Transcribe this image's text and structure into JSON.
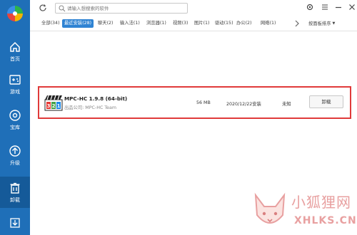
{
  "sidebar": {
    "logo_icon": "colorful-pinwheel-logo",
    "items": [
      {
        "label": "首页",
        "icon": "home-icon",
        "active": false
      },
      {
        "label": "游戏",
        "icon": "gamepad-icon",
        "active": false
      },
      {
        "label": "宝库",
        "icon": "disc-icon",
        "active": false
      },
      {
        "label": "升级",
        "icon": "upgrade-icon",
        "active": false
      },
      {
        "label": "卸载",
        "icon": "trash-icon",
        "active": true
      }
    ],
    "bottom_icon": "download-icon"
  },
  "titlebar": {
    "search_placeholder": "请输入想搜索的软件",
    "icons": [
      "refresh-icon",
      "settings-icon",
      "menu-icon",
      "minimize-icon",
      "close-icon"
    ]
  },
  "tabs": [
    {
      "label": "全部(34)",
      "active": false
    },
    {
      "label": "最近安装(28)",
      "active": true
    },
    {
      "label": "聊天(2)",
      "active": false
    },
    {
      "label": "输入法(1)",
      "active": false
    },
    {
      "label": "浏览器(1)",
      "active": false
    },
    {
      "label": "视频(3)",
      "active": false
    },
    {
      "label": "图片(1)",
      "active": false
    },
    {
      "label": "驱动(15)",
      "active": false
    },
    {
      "label": "办公(2)",
      "active": false
    },
    {
      "label": "网络(1)",
      "active": false
    }
  ],
  "sort_label": "按面板排序",
  "apps": [
    {
      "name": "MPC-HC 1.9.8 (64-bit)",
      "publisher": "出品公司: MPC-HC Team",
      "size": "56 MB",
      "install_date": "2020/12/22安装",
      "usage": "未知",
      "action_label": "卸载",
      "icon": "mpc-hc-icon"
    }
  ],
  "watermark": {
    "cn_text": "小狐狸网",
    "en_text": "XHLKS.CN",
    "icon": "fox-logo-icon"
  },
  "colors": {
    "sidebar": "#1f6fb8",
    "sidebar_active": "#155a99",
    "tab_active": "#2f83d3",
    "highlight_border": "#e03a3a",
    "watermark": "#e8a0a0"
  }
}
